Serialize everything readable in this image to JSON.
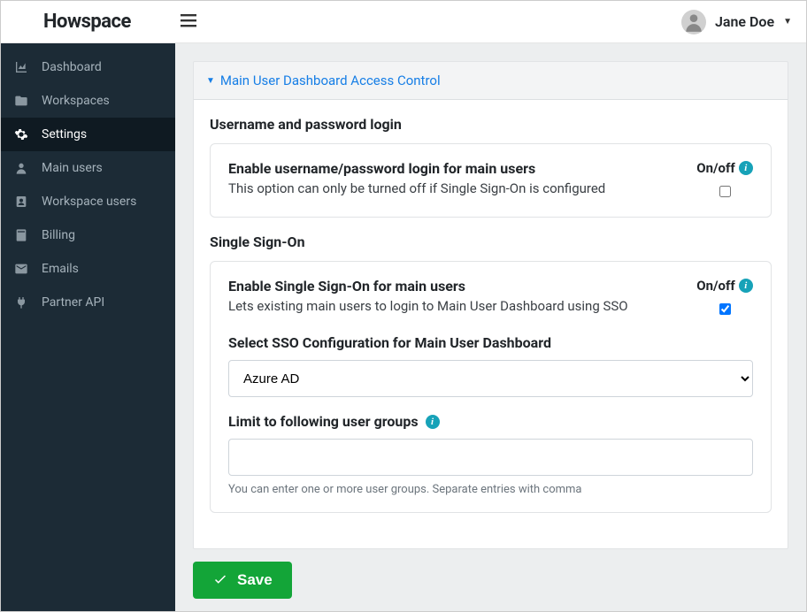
{
  "header": {
    "logo": "Howspace",
    "user_name": "Jane Doe"
  },
  "sidebar": {
    "items": [
      {
        "label": "Dashboard",
        "icon": "chart-area-icon",
        "active": false
      },
      {
        "label": "Workspaces",
        "icon": "folder-open-icon",
        "active": false
      },
      {
        "label": "Settings",
        "icon": "gear-icon",
        "active": true
      },
      {
        "label": "Main users",
        "icon": "user-icon",
        "active": false
      },
      {
        "label": "Workspace users",
        "icon": "user-badge-icon",
        "active": false
      },
      {
        "label": "Billing",
        "icon": "book-icon",
        "active": false
      },
      {
        "label": "Emails",
        "icon": "envelope-icon",
        "active": false
      },
      {
        "label": "Partner API",
        "icon": "plug-icon",
        "active": false
      }
    ]
  },
  "panel": {
    "title": "Main User Dashboard Access Control",
    "username_section": {
      "heading": "Username and password login",
      "option_title": "Enable username/password login for main users",
      "option_desc": "This option can only be turned off if Single Sign-On is configured",
      "onoff_label": "On/off",
      "checked": false
    },
    "sso_section": {
      "heading": "Single Sign-On",
      "option_title": "Enable Single Sign-On for main users",
      "option_desc": "Lets existing main users to login to Main User Dashboard using SSO",
      "onoff_label": "On/off",
      "checked": true,
      "select_label": "Select SSO Configuration for Main User Dashboard",
      "select_value": "Azure AD",
      "groups_label": "Limit to following user groups",
      "groups_value": "",
      "groups_helper": "You can enter one or more user groups. Separate entries with comma"
    },
    "save_label": "Save"
  }
}
